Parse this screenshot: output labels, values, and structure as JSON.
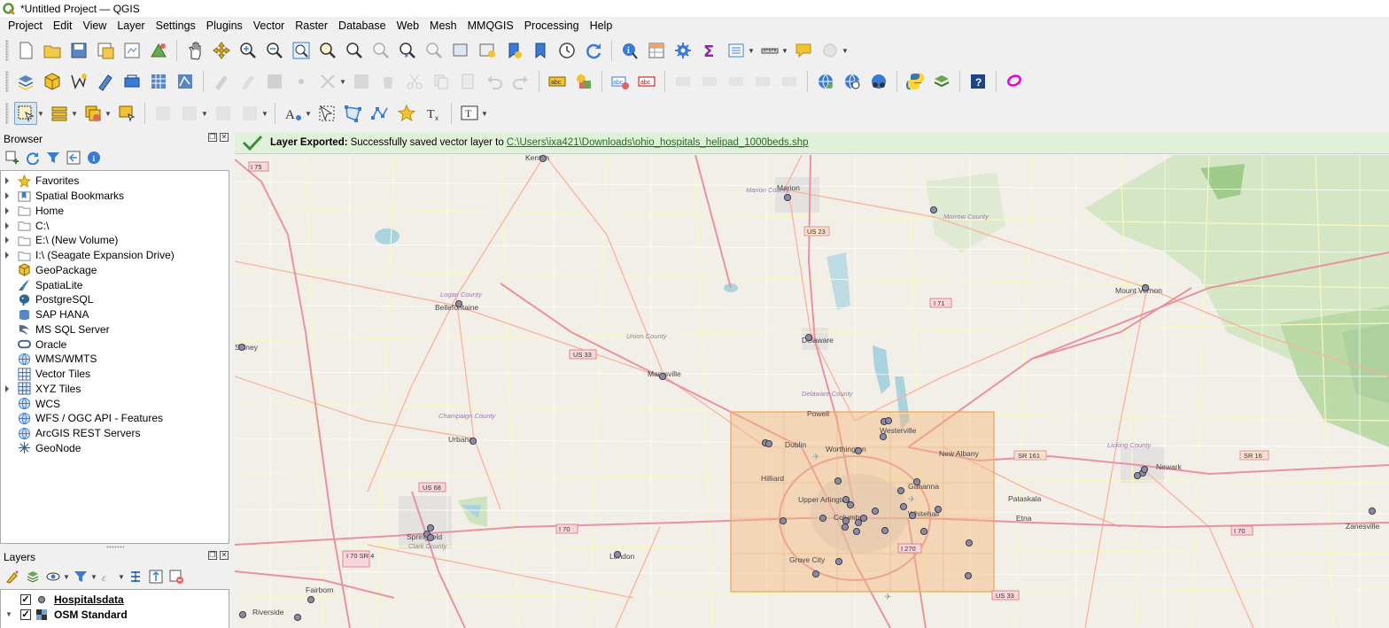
{
  "window": {
    "title": "*Untitled Project — QGIS"
  },
  "menubar": [
    "Project",
    "Edit",
    "View",
    "Layer",
    "Settings",
    "Plugins",
    "Vector",
    "Raster",
    "Database",
    "Web",
    "Mesh",
    "MMQGIS",
    "Processing",
    "Help"
  ],
  "browser": {
    "title": "Browser",
    "items": [
      {
        "label": "Favorites",
        "icon": "star-icon",
        "expandable": true
      },
      {
        "label": "Spatial Bookmarks",
        "icon": "bookmarks-icon",
        "expandable": true
      },
      {
        "label": "Home",
        "icon": "folder-icon",
        "expandable": true
      },
      {
        "label": "C:\\",
        "icon": "folder-icon",
        "expandable": true
      },
      {
        "label": "E:\\ (New Volume)",
        "icon": "folder-icon",
        "expandable": true
      },
      {
        "label": "I:\\ (Seagate Expansion Drive)",
        "icon": "folder-icon",
        "expandable": true
      },
      {
        "label": "GeoPackage",
        "icon": "geopackage-icon",
        "expandable": false
      },
      {
        "label": "SpatiaLite",
        "icon": "spatialite-icon",
        "expandable": false
      },
      {
        "label": "PostgreSQL",
        "icon": "postgresql-icon",
        "expandable": false
      },
      {
        "label": "SAP HANA",
        "icon": "sap-hana-icon",
        "expandable": false
      },
      {
        "label": "MS SQL Server",
        "icon": "mssql-icon",
        "expandable": false
      },
      {
        "label": "Oracle",
        "icon": "oracle-icon",
        "expandable": false
      },
      {
        "label": "WMS/WMTS",
        "icon": "globe-icon",
        "expandable": false
      },
      {
        "label": "Vector Tiles",
        "icon": "grid-icon",
        "expandable": false
      },
      {
        "label": "XYZ Tiles",
        "icon": "grid-icon",
        "expandable": true
      },
      {
        "label": "WCS",
        "icon": "globe-icon",
        "expandable": false
      },
      {
        "label": "WFS / OGC API - Features",
        "icon": "globe-icon",
        "expandable": false
      },
      {
        "label": "ArcGIS REST Servers",
        "icon": "globe-icon",
        "expandable": false
      },
      {
        "label": "GeoNode",
        "icon": "geonode-icon",
        "expandable": false
      }
    ]
  },
  "layers": {
    "title": "Layers",
    "items": [
      {
        "name": "Hospitalsdata",
        "checked": true,
        "symbol": "point",
        "underlined": true
      },
      {
        "name": "OSM Standard",
        "checked": true,
        "symbol": "raster",
        "underlined": false
      }
    ]
  },
  "message_bar": {
    "title": "Layer Exported:",
    "text": "Successfully saved vector layer to",
    "path": "C:\\Users\\ixa421\\Downloads\\ohio_hospitals_helipad_1000beds.shp",
    "color": "#dff2d9"
  },
  "map": {
    "cities": [
      "Kenton",
      "Marion",
      "Bellefontaine",
      "Marysville",
      "Delaware",
      "Mount Vernon",
      "Urbana",
      "Powell",
      "Westerville",
      "Dublin",
      "Worthington",
      "New Albany",
      "Hilliard",
      "Gahanna",
      "Upper Arlington",
      "Columbus",
      "Whitehall",
      "Pataskala",
      "Etna",
      "Newark",
      "Springfield",
      "London",
      "Grove City",
      "Fairborn",
      "Riverside",
      "Zanesville",
      "Sidney"
    ],
    "counties": [
      "Marion County",
      "Morrow County",
      "Logan County",
      "Union County",
      "Champaign County",
      "Licking County",
      "Clark County",
      "Delaware County"
    ],
    "highways": [
      "I 75",
      "US 23",
      "I 71",
      "US 33",
      "US 68",
      "I 70",
      "I 270",
      "SR 161",
      "SR 16",
      "US 33",
      "I 70",
      "I 70 SR 4"
    ],
    "colors": {
      "land": "#f2efe9",
      "forest": "#add19e",
      "water": "#aad3df",
      "urban": "#e0dfdf",
      "motorway": "#e892a2",
      "trunk": "#f9b29c",
      "road": "#f7fabf",
      "hospital_fill": "#8a8aa8",
      "selection": "#f4b77a"
    }
  }
}
